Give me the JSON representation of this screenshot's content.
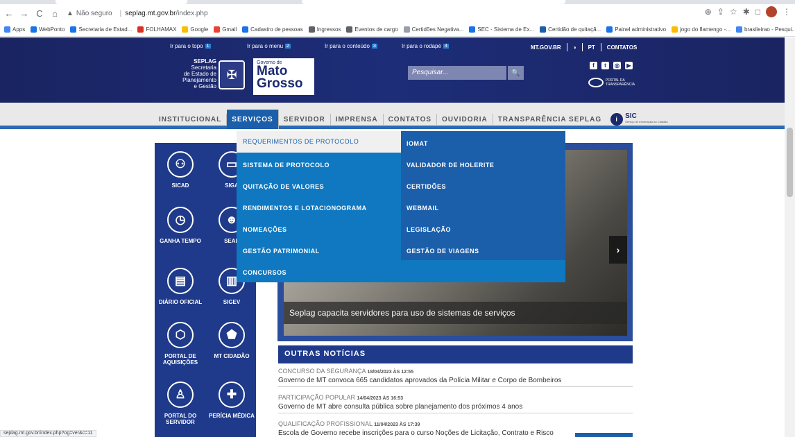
{
  "browser": {
    "security_label": "Não seguro",
    "host": "seplag.mt.gov.br",
    "path": "/index.php",
    "bookmarks": [
      "Apps",
      "WebPonto",
      "Secretaria de Estad...",
      "FOLHAMAX",
      "Google",
      "Gmail",
      "Cadastro de pessoas",
      "Ingressos",
      "Eventos de cargo",
      "Certidões Negativa...",
      "SEC - Sistema de Ex...",
      "Certidão de quitaçã...",
      "Painel administrativo",
      "jogo do flamengo -...",
      "brasileirao - Pesqui..."
    ],
    "status_url": "seplag.mt.gov.br/index.php?og=ver&c=11"
  },
  "accessibility": [
    {
      "label": "Ir para o topo",
      "num": "1"
    },
    {
      "label": "Ir para o menu",
      "num": "2"
    },
    {
      "label": "Ir para o conteúdo",
      "num": "3"
    },
    {
      "label": "Ir para o rodapé",
      "num": "4"
    }
  ],
  "top_links": {
    "mtgov": "MT.GOV.BR",
    "contrast": "◑",
    "lang": "PT",
    "contacts": "CONTATOS"
  },
  "header": {
    "seplag_title": "SEPLAG",
    "seplag_lines": [
      "Secretaria",
      "de Estado de",
      "Planejamento",
      "e Gestão"
    ],
    "logo_small": "Governo de",
    "logo_line1": "Mato",
    "logo_line2": "Grosso",
    "search_placeholder": "Pesquisar...",
    "portal_label": "PORTAL DA TRANSPARÊNCIA"
  },
  "nav": {
    "items": [
      "INSTITUCIONAL",
      "SERVIÇOS",
      "SERVIDOR",
      "IMPRENSA",
      "CONTATOS",
      "OUVIDORIA",
      "TRANSPARÊNCIA SEPLAG"
    ],
    "sic": "SIC",
    "sic_sub": "Serviço de Informação ao Cidadão"
  },
  "dropdown": {
    "left": [
      "REQUERIMENTOS DE PROTOCOLO",
      "SISTEMA DE PROTOCOLO",
      "QUITAÇÃO DE VALORES",
      "RENDIMENTOS E LOTACIONOGRAMA",
      "NOMEAÇÕES",
      "GESTÃO PATRIMONIAL",
      "CONCURSOS"
    ],
    "right": [
      "IOMAT",
      "VALIDADOR DE HOLERITE",
      "CERTIDÕES",
      "WEBMAIL",
      "LEGISLAÇÃO",
      "GESTÃO DE VIAGENS"
    ]
  },
  "quick_links": [
    "SICAD",
    "SIGA",
    "GANHA TEMPO",
    "SEAP",
    "DIÁRIO OFICIAL",
    "SIGEV",
    "PORTAL DE AQUISIÇÕES",
    "MT CIDADÃO",
    "PORTAL DO SERVIDOR",
    "PERÍCIA MÉDICA"
  ],
  "slider": {
    "caption": "Seplag capacita servidores para uso de sistemas de serviços"
  },
  "news": {
    "heading": "OUTRAS NOTÍCIAS",
    "items": [
      {
        "cat": "CONCURSO DA SEGURANÇA",
        "date": "18/04/2023 ÀS 12:55",
        "title": "Governo de MT convoca 665 candidatos aprovados da Polícia Militar e Corpo de Bombeiros"
      },
      {
        "cat": "PARTICIPAÇÃO POPULAR",
        "date": "14/04/2023 ÀS 16:53",
        "title": "Governo de MT abre consulta pública sobre planejamento dos próximos 4 anos"
      },
      {
        "cat": "QUALIFICAÇÃO PROFISSIONAL",
        "date": "11/04/2023 ÀS 17:39",
        "title": "Escola de Governo recebe inscrições para o curso Noções de Licitação, Contrato e Risco"
      }
    ]
  }
}
